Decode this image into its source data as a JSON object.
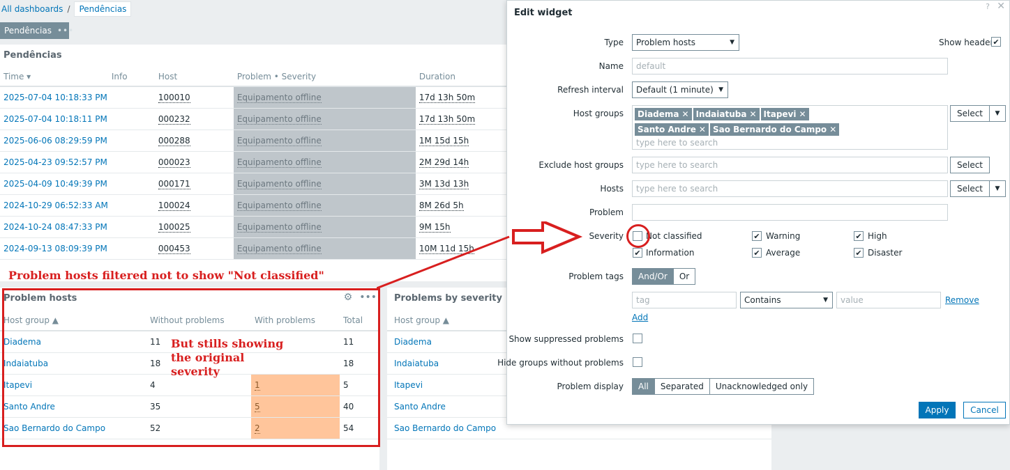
{
  "breadcrumb": {
    "root": "All dashboards",
    "separator": "/",
    "current": "Pendências"
  },
  "dashboard_tab": {
    "label": "Pendências",
    "dots": "•••"
  },
  "pendencias": {
    "title": "Pendências",
    "headers": [
      "Time ▾",
      "Info",
      "Host",
      "Problem • Severity",
      "Duration"
    ],
    "rows": [
      {
        "time": "2025-07-04 10:18:33 PM",
        "host": "100010",
        "problem": "Equipamento offline",
        "duration": "17d 13h 50m"
      },
      {
        "time": "2025-07-04 10:18:11 PM",
        "host": "000232",
        "problem": "Equipamento offline",
        "duration": "17d 13h 50m"
      },
      {
        "time": "2025-06-06 08:29:59 PM",
        "host": "000288",
        "problem": "Equipamento offline",
        "duration": "1M 15d 15h"
      },
      {
        "time": "2025-04-23 09:52:57 PM",
        "host": "000023",
        "problem": "Equipamento offline",
        "duration": "2M 29d 14h"
      },
      {
        "time": "2025-04-09 10:49:39 PM",
        "host": "000171",
        "problem": "Equipamento offline",
        "duration": "3M 13d 13h"
      },
      {
        "time": "2024-10-29 06:52:33 AM",
        "host": "100024",
        "problem": "Equipamento offline",
        "duration": "8M 26d 5h"
      },
      {
        "time": "2024-10-24 08:47:33 PM",
        "host": "100025",
        "problem": "Equipamento offline",
        "duration": "9M 15h"
      },
      {
        "time": "2024-09-13 08:09:39 PM",
        "host": "000453",
        "problem": "Equipamento offline",
        "duration": "10M 11d 15h"
      }
    ]
  },
  "annotations": {
    "a1": "Problem hosts filtered not to show \"Not classified\"",
    "a2": "But stills showing the original severity"
  },
  "problem_hosts": {
    "title": "Problem hosts",
    "headers": [
      "Host group ▲",
      "Without problems",
      "With problems",
      "Total"
    ],
    "rows": [
      {
        "group": "Diadema",
        "without": "11",
        "with": "",
        "total": "11"
      },
      {
        "group": "Indaiatuba",
        "without": "18",
        "with": "",
        "total": "18"
      },
      {
        "group": "Itapevi",
        "without": "4",
        "with": "1",
        "total": "5"
      },
      {
        "group": "Santo Andre",
        "without": "35",
        "with": "5",
        "total": "40"
      },
      {
        "group": "Sao Bernardo do Campo",
        "without": "52",
        "with": "2",
        "total": "54"
      }
    ],
    "gear_icon": "⚙",
    "dots": "•••"
  },
  "problems_by_severity": {
    "title": "Problems by severity",
    "header": "Host group ▲",
    "rows": [
      "Diadema",
      "Indaiatuba",
      "Itapevi",
      "Santo Andre",
      "Sao Bernardo do Campo"
    ]
  },
  "modal": {
    "title": "Edit widget",
    "help": "?",
    "close": "✕",
    "type_label": "Type",
    "type_value": "Problem hosts",
    "show_header_label": "Show header",
    "name_label": "Name",
    "name_placeholder": "default",
    "refresh_label": "Refresh interval",
    "refresh_value": "Default (1 minute)",
    "host_groups_label": "Host groups",
    "host_groups": [
      "Diadema",
      "Indaiatuba",
      "Itapevi",
      "Santo Andre",
      "Sao Bernardo do Campo"
    ],
    "search_placeholder": "type here to search",
    "select_label": "Select",
    "exclude_label": "Exclude host groups",
    "hosts_label": "Hosts",
    "problem_label": "Problem",
    "severity_label": "Severity",
    "severities": {
      "not_classified": "Not classified",
      "information": "Information",
      "warning": "Warning",
      "average": "Average",
      "high": "High",
      "disaster": "Disaster"
    },
    "tags_label": "Problem tags",
    "and_or": "And/Or",
    "or": "Or",
    "tag_placeholder": "tag",
    "contains": "Contains",
    "value_placeholder": "value",
    "remove": "Remove",
    "add": "Add",
    "suppressed_label": "Show suppressed problems",
    "hide_groups_label": "Hide groups without problems",
    "display_label": "Problem display",
    "display_options": [
      "All",
      "Separated",
      "Unacknowledged only"
    ],
    "apply": "Apply",
    "cancel": "Cancel"
  },
  "colors": {
    "accent": "#0275b8",
    "annotation": "#d81f1f",
    "problem_cell": "#bfc6cb",
    "with_problems": "#ffc59b"
  }
}
